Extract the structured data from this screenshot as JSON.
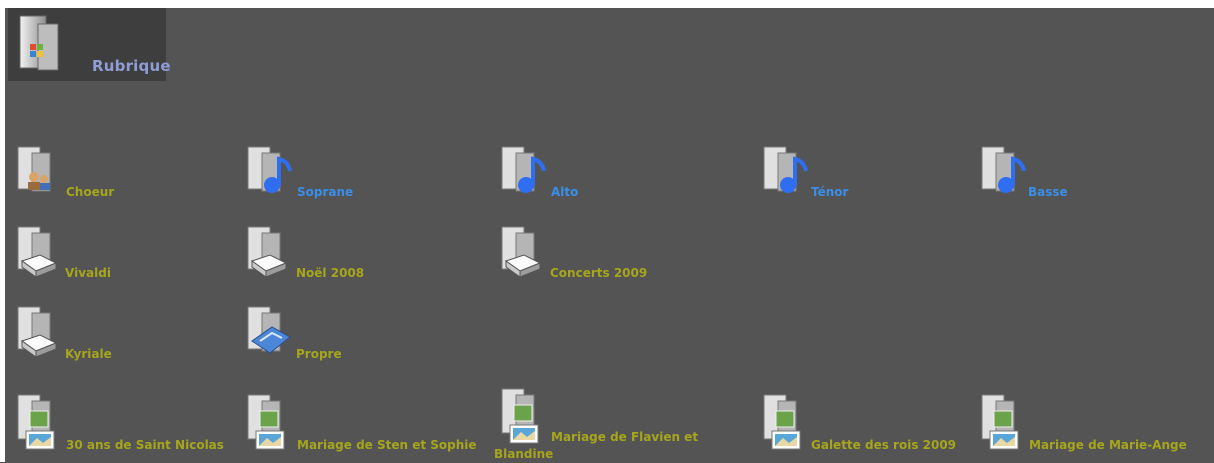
{
  "header": {
    "label": "Rubrique",
    "icon": "windows-folder-icon"
  },
  "colors": {
    "background": "#545454",
    "text_yellow": "#a7a51c",
    "text_blue": "#3a8ee8",
    "rubrique_text": "#8f9cd6"
  },
  "rows": [
    [
      {
        "label": "Choeur",
        "icon": "people-folder-icon",
        "color": "yellow"
      },
      {
        "label": "Soprane",
        "icon": "music-folder-icon",
        "color": "blue"
      },
      {
        "label": "Alto",
        "icon": "music-folder-icon",
        "color": "blue"
      },
      {
        "label": "Ténor",
        "icon": "music-folder-icon",
        "color": "blue"
      },
      {
        "label": "Basse",
        "icon": "music-folder-icon",
        "color": "blue"
      }
    ],
    [
      {
        "label": "Vivaldi",
        "icon": "drive-folder-icon",
        "color": "yellow"
      },
      {
        "label": "Noël 2008",
        "icon": "drive-folder-icon",
        "color": "yellow"
      },
      {
        "label": "Concerts 2009",
        "icon": "drive-folder-icon",
        "color": "yellow"
      }
    ],
    [
      {
        "label": "Kyriale",
        "icon": "drive-folder-icon",
        "color": "yellow"
      },
      {
        "label": "Propre",
        "icon": "document-folder-icon",
        "color": "yellow"
      }
    ],
    [
      {
        "label": "30 ans de Saint Nicolas",
        "icon": "pictures-folder-icon",
        "color": "yellow"
      },
      {
        "label": "Mariage de Sten et Sophie",
        "icon": "pictures-folder-icon",
        "color": "yellow"
      },
      {
        "label": "Mariage de Flavien et Blandine",
        "icon": "pictures-folder-icon",
        "color": "yellow"
      },
      {
        "label": "Galette des rois 2009",
        "icon": "pictures-folder-icon",
        "color": "yellow"
      },
      {
        "label": "Mariage de Marie-Ange",
        "icon": "pictures-folder-icon",
        "color": "yellow"
      }
    ]
  ]
}
